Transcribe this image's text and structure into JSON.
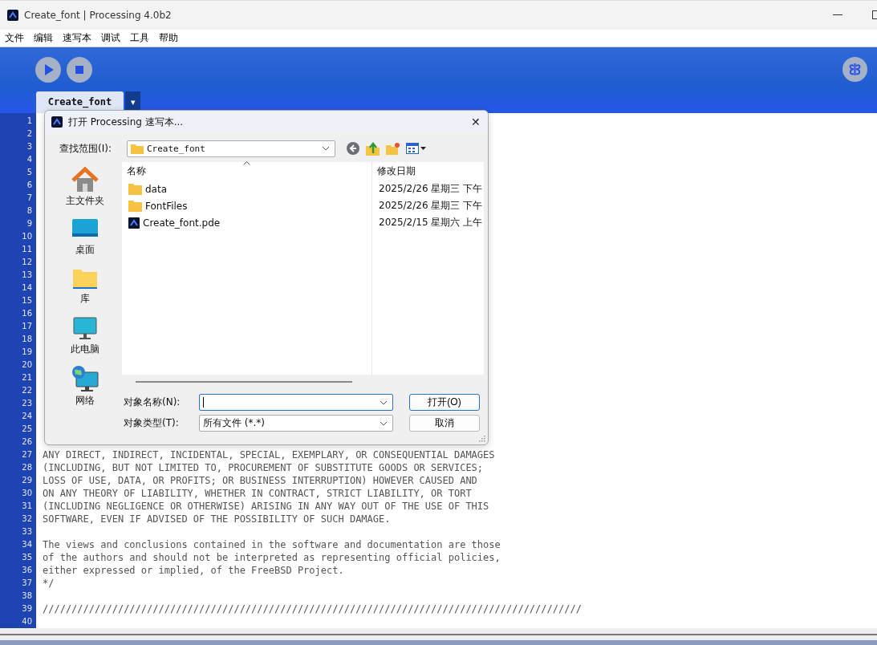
{
  "window": {
    "title": "Create_font | Processing 4.0b2"
  },
  "menu": [
    "文件",
    "编辑",
    "速写本",
    "调试",
    "工具",
    "帮助"
  ],
  "tabs": [
    {
      "label": "Create_font",
      "selected": true
    }
  ],
  "tab_menu": "▾",
  "editor": {
    "lines": [
      {
        "number": "1"
      },
      {
        "number": "2"
      },
      {
        "number": "3"
      },
      {
        "number": "4"
      },
      {
        "number": "5"
      },
      {
        "number": "6"
      },
      {
        "number": "7"
      },
      {
        "number": "8"
      },
      {
        "number": "9"
      },
      {
        "number": "10"
      },
      {
        "number": "11"
      },
      {
        "number": "12"
      },
      {
        "number": "13"
      },
      {
        "number": "14"
      },
      {
        "number": "15"
      },
      {
        "number": "16"
      },
      {
        "number": "17"
      },
      {
        "number": "18"
      },
      {
        "number": "19"
      },
      {
        "number": "20"
      },
      {
        "number": "21"
      },
      {
        "number": "22"
      },
      {
        "number": "23"
      },
      {
        "number": "24"
      },
      {
        "number": "25"
      },
      {
        "number": "26"
      },
      {
        "number": "27",
        "text": "ANY DIRECT, INDIRECT, INCIDENTAL, SPECIAL, EXEMPLARY, OR CONSEQUENTIAL DAMAGES"
      },
      {
        "number": "28",
        "text": "(INCLUDING, BUT NOT LIMITED TO, PROCUREMENT OF SUBSTITUTE GOODS OR SERVICES;"
      },
      {
        "number": "29",
        "text": "LOSS OF USE, DATA, OR PROFITS; OR BUSINESS INTERRUPTION) HOWEVER CAUSED AND"
      },
      {
        "number": "30",
        "text": "ON ANY THEORY OF LIABILITY, WHETHER IN CONTRACT, STRICT LIABILITY, OR TORT"
      },
      {
        "number": "31",
        "text": "(INCLUDING NEGLIGENCE OR OTHERWISE) ARISING IN ANY WAY OUT OF THE USE OF THIS"
      },
      {
        "number": "32",
        "text": "SOFTWARE, EVEN IF ADVISED OF THE POSSIBILITY OF SUCH DAMAGE."
      },
      {
        "number": "33"
      },
      {
        "number": "34",
        "text": "The views and conclusions contained in the software and documentation are those"
      },
      {
        "number": "35",
        "text": "of the authors and should not be interpreted as representing official policies,"
      },
      {
        "number": "36",
        "text": "either expressed or implied, of the FreeBSD Project."
      },
      {
        "number": "37",
        "text": "*/"
      },
      {
        "number": "38"
      },
      {
        "number": "39",
        "text": "/////////////////////////////////////////////////////////////////////////////////////////////"
      },
      {
        "number": "40"
      }
    ]
  },
  "dialog": {
    "title": "打开 Processing 速写本...",
    "close": "✕",
    "look_in": {
      "label": "查找范围(I):",
      "value": "Create_font"
    },
    "places": [
      {
        "label": "主文件夹",
        "kind": "home"
      },
      {
        "label": "桌面",
        "kind": "desktop"
      },
      {
        "label": "库",
        "kind": "library"
      },
      {
        "label": "此电脑",
        "kind": "computer"
      },
      {
        "label": "网络",
        "kind": "network"
      }
    ],
    "columns": [
      "名称",
      "修改日期"
    ],
    "files": [
      {
        "name": "data",
        "kind": "folder",
        "date": "2025/2/26 星期三 下午"
      },
      {
        "name": "FontFiles",
        "kind": "folder",
        "date": "2025/2/26 星期三 下午"
      },
      {
        "name": "Create_font.pde",
        "kind": "sketch",
        "date": "2025/2/15 星期六 上午"
      }
    ],
    "file_name": {
      "label": "对象名称(N):",
      "focused": true
    },
    "file_type": {
      "label": "对象类型(T):",
      "value": "所有文件 (*.*)"
    },
    "buttons": [
      "打开(O)",
      "取消"
    ]
  }
}
